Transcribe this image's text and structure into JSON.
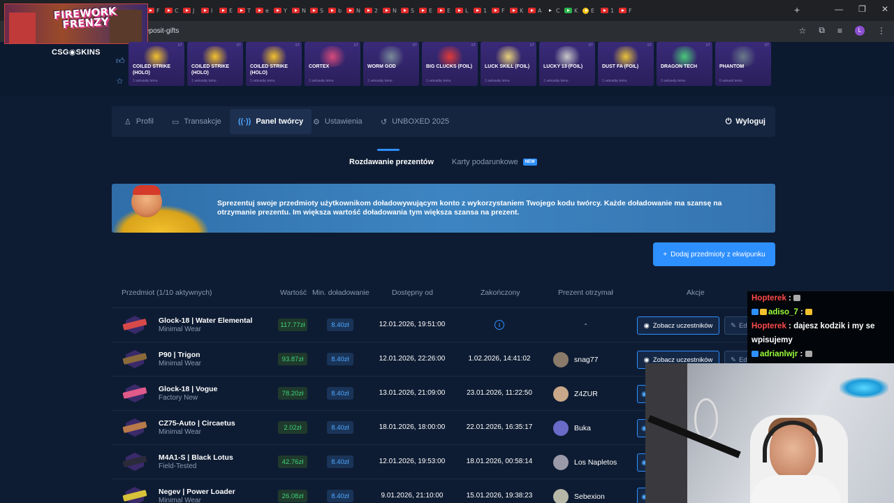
{
  "browser": {
    "url": "eposit-gifts",
    "tab_letters": [
      "F",
      "C",
      "J",
      "I",
      "E",
      "T",
      "e",
      "Y",
      "N",
      "S",
      "b",
      "N",
      "2",
      "N",
      "S",
      "E",
      "E",
      "L",
      "1",
      "F",
      "K",
      "A",
      "C",
      "K",
      "E",
      "1",
      "F"
    ],
    "new_tab": "+",
    "controls": [
      "—",
      "❐",
      "✕"
    ],
    "avatar_letter": "L"
  },
  "game_overlay": {
    "title_line1": "FIREWORK",
    "title_line2": "FRENZY"
  },
  "site": {
    "logo": "CSG◉SKINS",
    "drops": [
      {
        "name": "COILED STRIKE (HOLO)",
        "sub": "1 sekundę temu",
        "color": "#f2c12e"
      },
      {
        "name": "COILED STRIKE (HOLO)",
        "sub": "1 sekundę temu",
        "color": "#f2c12e"
      },
      {
        "name": "COILED STRIKE (HOLO)",
        "sub": "1 sekundę temu",
        "color": "#f2c12e"
      },
      {
        "name": "CORTEX",
        "sub": "1 sekundę temu",
        "color": "#d84a7a"
      },
      {
        "name": "WORM GOD",
        "sub": "1 sekundę temu",
        "color": "#7a8a9a"
      },
      {
        "name": "BIG CLUCKS (FOIL)",
        "sub": "1 sekundę temu",
        "color": "#e03a3a"
      },
      {
        "name": "LUCK SKILL (FOIL)",
        "sub": "1 sekundę temu",
        "color": "#e8d27a"
      },
      {
        "name": "LUCKY 13 (FOIL)",
        "sub": "1 sekundę temu",
        "color": "#c8c8c8"
      },
      {
        "name": "DUST FA (FOIL)",
        "sub": "1 sekundę temu",
        "color": "#e8c23a"
      },
      {
        "name": "DRAGON TECH",
        "sub": "2 sekundy temu",
        "color": "#4ac87a"
      },
      {
        "name": "PHANTOM",
        "sub": "6 sekund temu",
        "color": "#6a7a8a"
      }
    ]
  },
  "nav": {
    "items": [
      "Profil",
      "Transakcje",
      "Panel twórcy",
      "Ustawienia",
      "UNBOXED 2025"
    ],
    "logout": "Wyloguj"
  },
  "subtabs": {
    "active": "Rozdawanie prezentów",
    "other": "Karty podarunkowe",
    "badge": "NEW"
  },
  "banner": {
    "text": "Sprezentuj swoje przedmioty użytkownikom doładowywującym konto z wykorzystaniem Twojego kodu twórcy. Każde doładowanie ma szansę na otrzymanie prezentu. Im większa wartość doładowania tym większa szansa na prezent."
  },
  "add_button": "Dodaj przedmioty z ekwipunku",
  "table": {
    "headers": [
      "Przedmiot (1/10 aktywnych)",
      "Wartość",
      "Min. doładowanie",
      "Dostępny od",
      "Zakończony",
      "Prezent otrzymał",
      "Akcje"
    ],
    "view_label": "Zobacz uczestników",
    "edit_label": "Ed",
    "rows": [
      {
        "name": "Glock-18 | Water Elemental",
        "wear": "Minimal Wear",
        "value": "117.77zł",
        "min": "8.40zł",
        "from": "12.01.2026, 19:51:00",
        "ended": "",
        "winner": "-",
        "gun": "#d84a4a",
        "av": ""
      },
      {
        "name": "P90 | Trigon",
        "wear": "Minimal Wear",
        "value": "93.87zł",
        "min": "8.40zł",
        "from": "12.01.2026, 22:26:00",
        "ended": "1.02.2026, 14:41:02",
        "winner": "snag77",
        "gun": "#8a6a3a",
        "av": "#8a7a6a"
      },
      {
        "name": "Glock-18 | Vogue",
        "wear": "Factory New",
        "value": "78.20zł",
        "min": "8.40zł",
        "from": "13.01.2026, 21:09:00",
        "ended": "23.01.2026, 11:22:50",
        "winner": "Z4ZUR",
        "gun": "#e05a8a",
        "av": "#c8a888"
      },
      {
        "name": "CZ75-Auto | Circaetus",
        "wear": "Minimal Wear",
        "value": "2.02zł",
        "min": "8.40zł",
        "from": "18.01.2026, 18:00:00",
        "ended": "22.01.2026, 16:35:17",
        "winner": "Buka",
        "gun": "#b87a4a",
        "av": "#6a6ac8"
      },
      {
        "name": "M4A1-S | Black Lotus",
        "wear": "Field-Tested",
        "value": "42.76zł",
        "min": "8.40zł",
        "from": "12.01.2026, 19:53:00",
        "ended": "18.01.2026, 00:58:14",
        "winner": "Los Napletos",
        "gun": "#2a2a3a",
        "av": "#9a9aa8"
      },
      {
        "name": "Negev | Power Loader",
        "wear": "Minimal Wear",
        "value": "26.08zł",
        "min": "8.40zł",
        "from": "9.01.2026, 21:10:00",
        "ended": "15.01.2026, 19:38:23",
        "winner": "Sebexion",
        "gun": "#d8c23a",
        "av": "#b8b8a8"
      }
    ]
  },
  "chat": [
    {
      "user": "Hopterek",
      "msg": ""
    },
    {
      "user": "adiso_7",
      "msg": ""
    },
    {
      "user": "Hopterek",
      "msg": "dajesz kodzik i my se wpisujemy"
    },
    {
      "user": "adrianlwjr",
      "msg": ""
    }
  ]
}
